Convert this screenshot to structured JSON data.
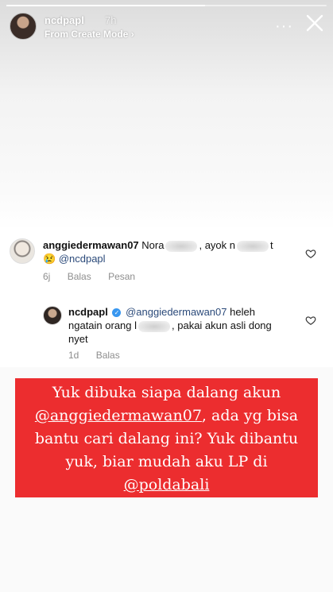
{
  "story": {
    "username": "ncdpapl",
    "time": "7h",
    "mode": "From Create Mode",
    "mode_chevron": "›",
    "more_icon": "···",
    "progress": 0.62
  },
  "comments": [
    {
      "username": "anggiedermawan07",
      "text_before": "Nora",
      "text_middle": ", ayok n",
      "text_end": "t",
      "emoji": "😢",
      "mention": "@ncdpapl",
      "age": "6j",
      "reply_label": "Balas",
      "message_label": "Pesan"
    },
    {
      "username": "ncdpapl",
      "mention": "@anggiedermawan07",
      "text_part1": "heleh",
      "text_part2": "ngatain orang l",
      "text_part3": ", pakai akun asli dong",
      "text_part4": "nyet",
      "age": "1d",
      "reply_label": "Balas"
    }
  ],
  "caption": {
    "line1": "Yuk dibuka siapa dalang akun",
    "line2_mention": "@anggiedermawan07",
    "line2_rest": ", ada yg bisa",
    "line3": "bantu cari dalang ini? Yuk dibantu",
    "line4": "yuk, biar mudah aku LP di",
    "line5_mention": "@poldabali",
    "bg_color": "#ec2d2f"
  }
}
